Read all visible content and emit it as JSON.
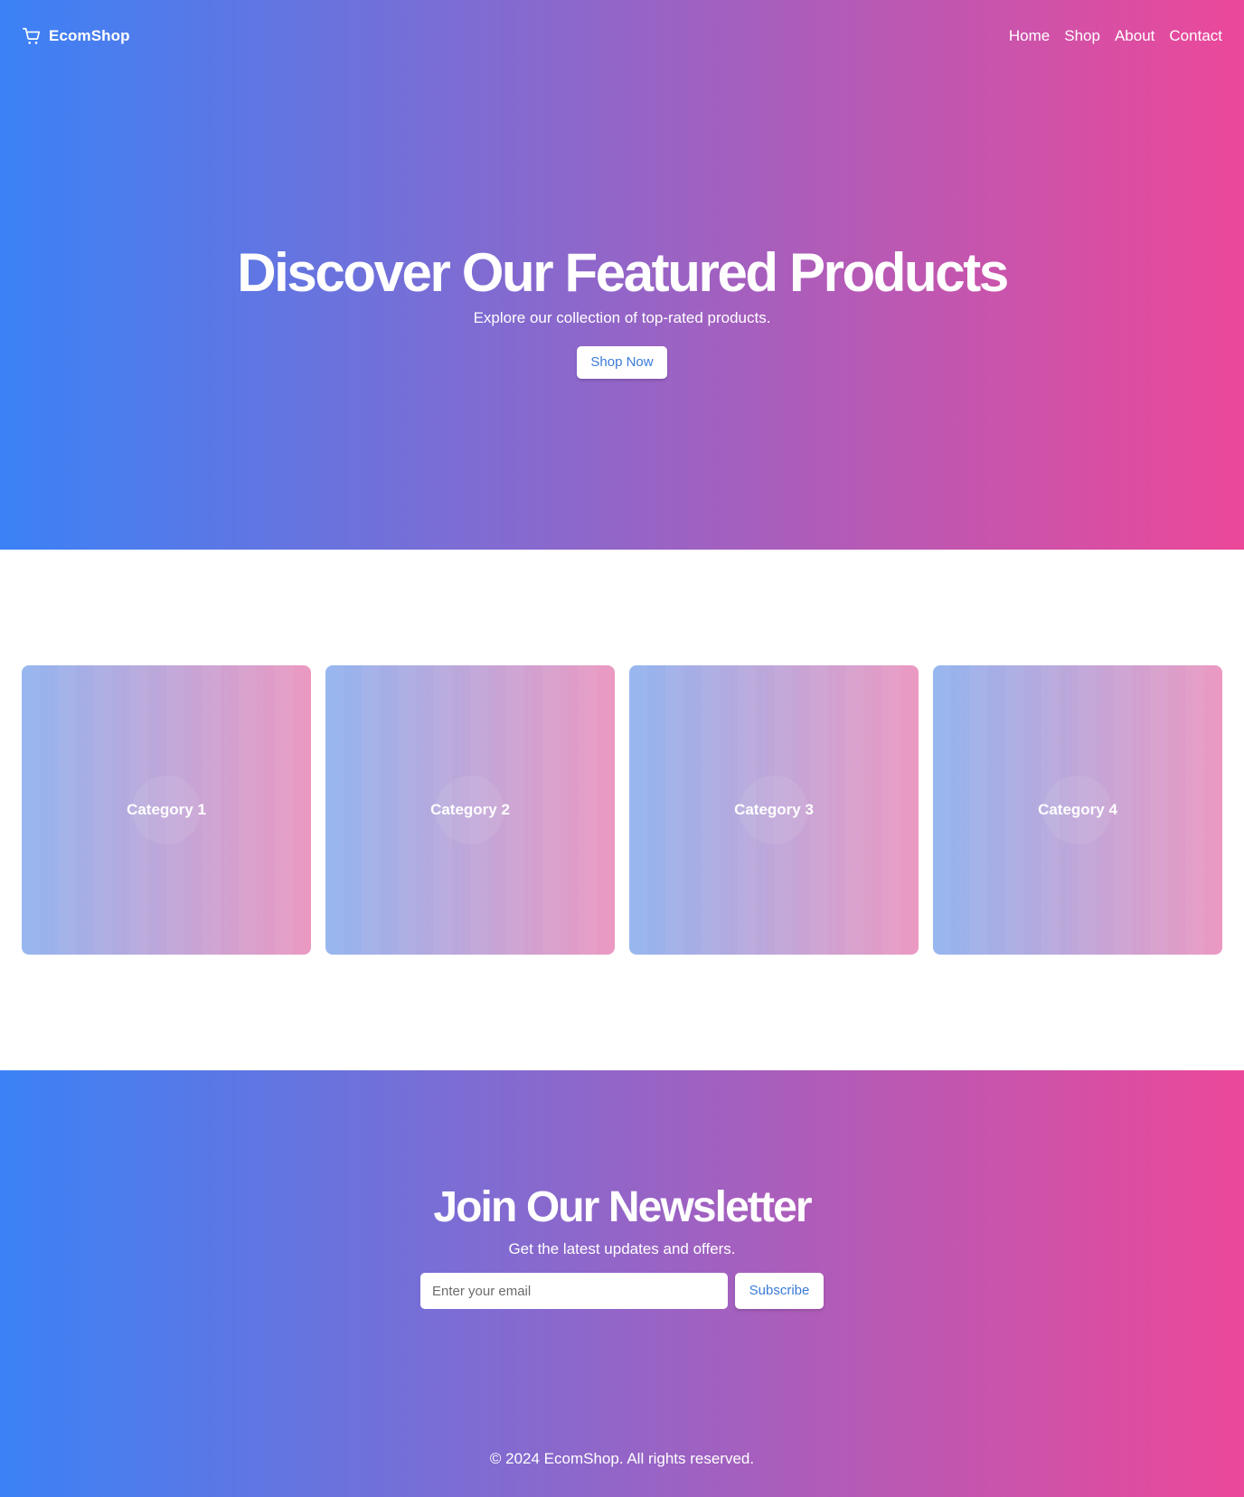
{
  "header": {
    "brand": "EcomShop",
    "brand_icon": "shopping-cart-icon",
    "nav": [
      {
        "label": "Home"
      },
      {
        "label": "Shop"
      },
      {
        "label": "About"
      },
      {
        "label": "Contact"
      }
    ]
  },
  "hero": {
    "title": "Discover Our Featured Products",
    "subtitle": "Explore our collection of top-rated products.",
    "cta_label": "Shop Now"
  },
  "categories": [
    {
      "label": "Category 1"
    },
    {
      "label": "Category 2"
    },
    {
      "label": "Category 3"
    },
    {
      "label": "Category 4"
    }
  ],
  "newsletter": {
    "title": "Join Our Newsletter",
    "subtitle": "Get the latest updates and offers.",
    "email_placeholder": "Enter your email",
    "subscribe_label": "Subscribe"
  },
  "footer": {
    "copyright": "© 2024 EcomShop. All rights reserved."
  },
  "colors": {
    "gradient_start": "#3b82f6",
    "gradient_end": "#ec4899",
    "button_text": "#3b7bd8"
  }
}
